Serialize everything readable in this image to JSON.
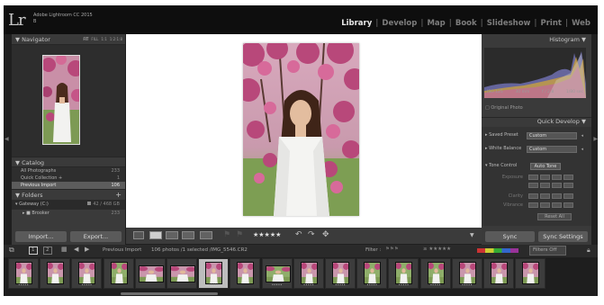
{
  "app": {
    "logo": "Lr",
    "name": "Adobe Lightroom CC 2015",
    "catalog": "B"
  },
  "modules": [
    "Library",
    "Develop",
    "Map",
    "Book",
    "Slideshow",
    "Print",
    "Web"
  ],
  "active_module": "Library",
  "navigator": {
    "title": "Navigator",
    "zoom": [
      "FIT",
      "FILL",
      "1:1",
      "1:2:1:8"
    ]
  },
  "catalog": {
    "title": "Catalog",
    "items": [
      {
        "label": "All Photographs",
        "count": "233"
      },
      {
        "label": "Quick Collection +",
        "count": "1"
      },
      {
        "label": "Previous Import",
        "count": "106"
      }
    ]
  },
  "folders": {
    "title": "Folders",
    "add": "+",
    "volume": {
      "label": "Gateway (C:)",
      "info": "42 / 468 GB"
    },
    "items": [
      {
        "label": "Brooker",
        "count": "233"
      }
    ]
  },
  "left_buttons": {
    "import": "Import...",
    "export": "Export..."
  },
  "toolbar": {
    "stars": "★★★★★"
  },
  "histogram": {
    "title": "Histogram",
    "info": [
      "ISO 125",
      "30 mm",
      "f / 2.8",
      "1/80 sec"
    ],
    "original": "Original Photo"
  },
  "quick_develop": {
    "title": "Quick Develop",
    "saved_preset_label": "Saved Preset",
    "saved_preset_value": "Custom",
    "white_balance_label": "White Balance",
    "white_balance_value": "Custom",
    "tone_control_label": "Tone Control",
    "auto_tone": "Auto Tone",
    "exposure": "Exposure",
    "clarity": "Clarity",
    "vibrance": "Vibrance",
    "reset_all": "Reset All"
  },
  "right_buttons": {
    "sync": "Sync",
    "sync_settings": "Sync Settings"
  },
  "filmstrip_bar": {
    "page1": "1",
    "page2": "2",
    "source": "Previous Import",
    "selection": "106 photos /1 selected /IMG_5546.CR2",
    "filter_label": "Filter :",
    "filters_off": "Filters Off"
  },
  "filmstrip": {
    "count": 17,
    "selected_index": 6
  },
  "colors": {
    "top_bar": "#0e0e0e",
    "panel": "#3a3a3a",
    "canvas": "#ffffff",
    "selected_row": "#5c5c5c",
    "blossom": "#b8487a",
    "foliage": "#6a8d3a"
  }
}
